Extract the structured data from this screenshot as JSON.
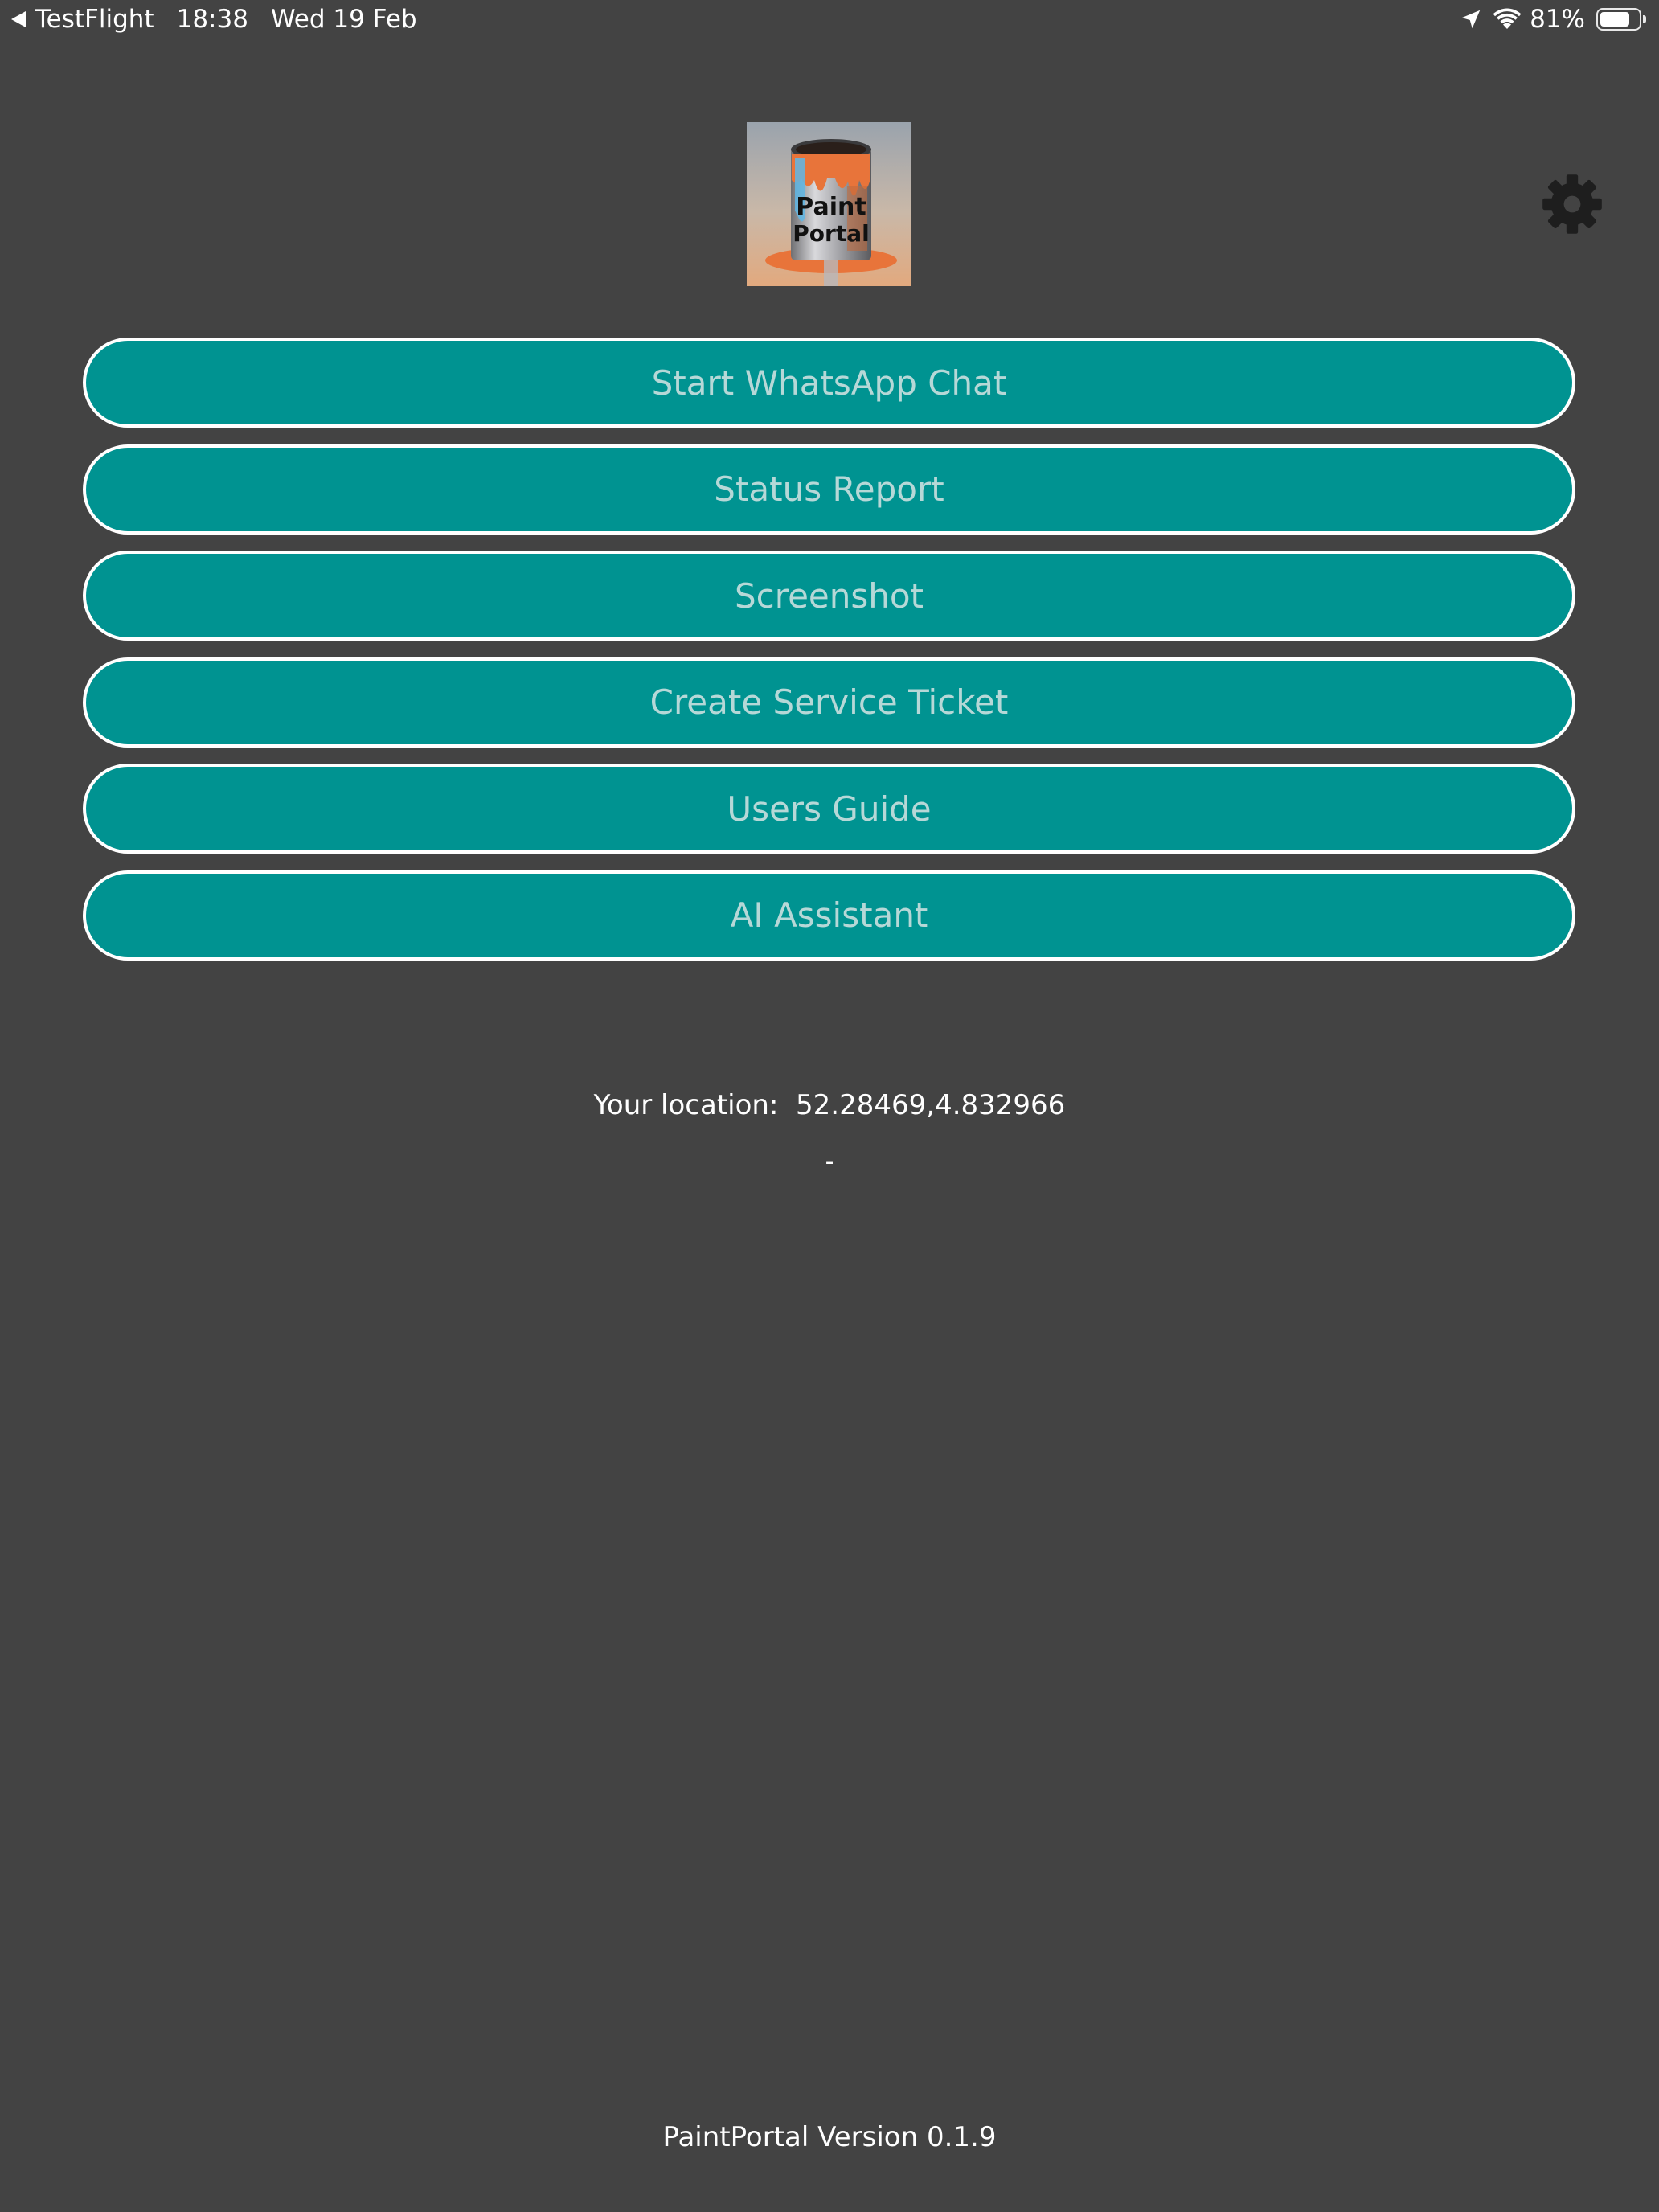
{
  "status_bar": {
    "back_app": "TestFlight",
    "time": "18:38",
    "date": "Wed 19 Feb",
    "battery_percent": "81%",
    "battery_level": 0.81,
    "icons": [
      "location-arrow-icon",
      "wifi-icon",
      "battery-icon"
    ]
  },
  "header": {
    "logo_text_line1": "Paint",
    "logo_text_line2": "Portal",
    "settings_icon": "gear-icon"
  },
  "buttons": [
    {
      "label": "Start WhatsApp Chat"
    },
    {
      "label": "Status Report"
    },
    {
      "label": "Screenshot"
    },
    {
      "label": "Create Service Ticket"
    },
    {
      "label": "Users Guide"
    },
    {
      "label": "AI Assistant"
    }
  ],
  "location": {
    "label": "Your location:",
    "value": "52.28469,4.832966",
    "secondary": "-"
  },
  "footer": {
    "version": "PaintPortal Version 0.1.9"
  },
  "colors": {
    "background": "#434343",
    "button_fill": "#009391",
    "button_border": "#ffffff",
    "button_text": "#b6d8d7",
    "gear": "#1e1e1e"
  }
}
